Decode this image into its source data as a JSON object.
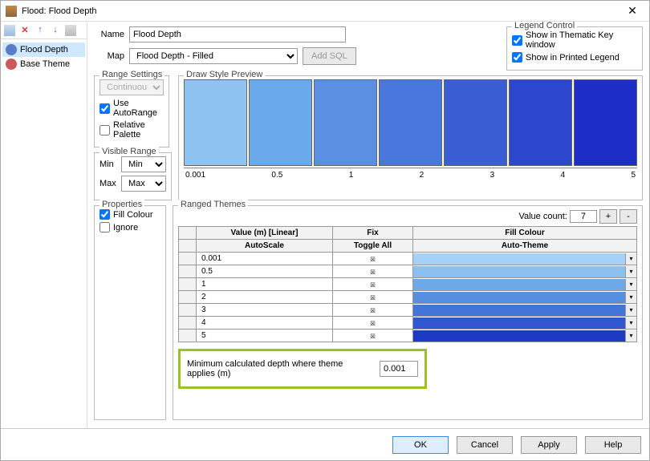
{
  "window": {
    "title": "Flood: Flood Depth"
  },
  "tree": {
    "items": [
      {
        "label": "Flood Depth",
        "selected": true,
        "iconColor": "#5a7cc8"
      },
      {
        "label": "Base Theme",
        "selected": false,
        "iconColor": "#cc5a5a"
      }
    ]
  },
  "fields": {
    "name_label": "Name",
    "name_value": "Flood Depth",
    "map_label": "Map",
    "map_value": "Flood Depth - Filled",
    "add_sql": "Add SQL"
  },
  "legend_control": {
    "title": "Legend Control",
    "show_thematic": "Show in Thematic Key window",
    "show_printed": "Show in Printed Legend"
  },
  "range_settings": {
    "title": "Range Settings",
    "mode": "Continuous",
    "use_autorange": "Use AutoRange",
    "relative_palette": "Relative Palette"
  },
  "visible_range": {
    "title": "Visible Range",
    "min_label": "Min",
    "min_value": "Min",
    "max_label": "Max",
    "max_value": "Max"
  },
  "draw_preview": {
    "title": "Draw Style Preview",
    "colors": [
      "#8fc3f0",
      "#6aa9ea",
      "#5a8fe2",
      "#4a77db",
      "#3b5ed4",
      "#2c46cd",
      "#1d2ec6"
    ],
    "ticks": [
      "0.001",
      "0.5",
      "1",
      "2",
      "3",
      "4",
      "5"
    ]
  },
  "properties": {
    "title": "Properties",
    "fill_colour": "Fill Colour",
    "ignore": "Ignore"
  },
  "ranged": {
    "title": "Ranged Themes",
    "value_count_label": "Value count:",
    "value_count": "7",
    "plus": "+",
    "minus": "-",
    "col_value": "Value (m) [Linear]",
    "col_fix": "Fix",
    "col_fill": "Fill Colour",
    "sub_autoscale": "AutoScale",
    "sub_toggle": "Toggle All",
    "sub_autotheme": "Auto-Theme",
    "rows": [
      {
        "value": "0.001",
        "color": "#a6d0f5"
      },
      {
        "value": "0.5",
        "color": "#8abfef"
      },
      {
        "value": "1",
        "color": "#6ea8e8"
      },
      {
        "value": "2",
        "color": "#578ee0"
      },
      {
        "value": "3",
        "color": "#4374d8"
      },
      {
        "value": "4",
        "color": "#3057cf"
      },
      {
        "value": "5",
        "color": "#1e3ac5"
      }
    ]
  },
  "min_depth": {
    "label": "Minimum calculated depth where theme applies (m)",
    "value": "0.001"
  },
  "footer": {
    "ok": "OK",
    "cancel": "Cancel",
    "apply": "Apply",
    "help": "Help"
  }
}
